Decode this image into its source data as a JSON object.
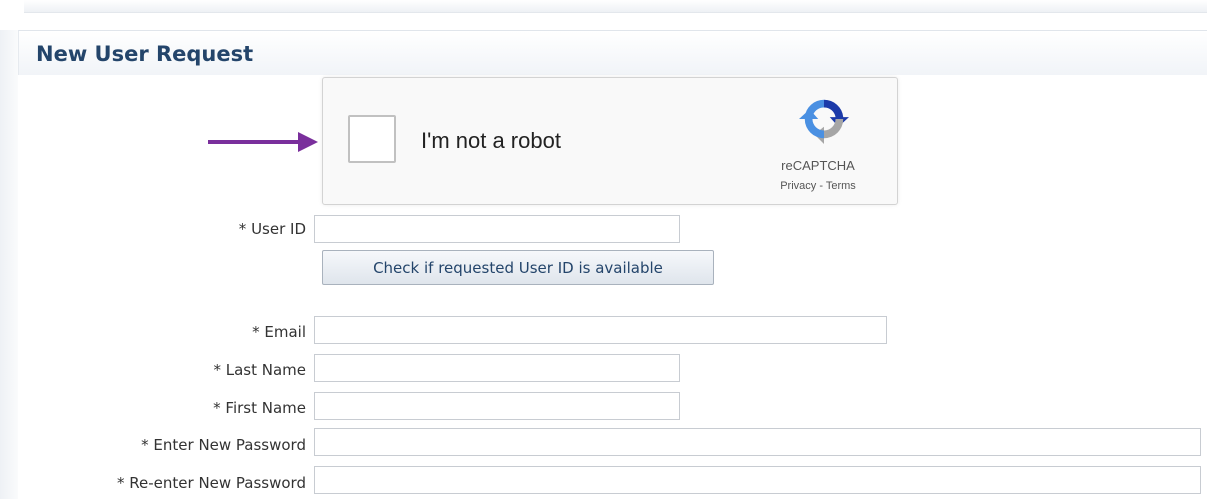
{
  "page": {
    "title": "New User Request"
  },
  "recaptcha": {
    "checkbox_label": "I'm not a robot",
    "brand": "reCAPTCHA",
    "privacy_link": "Privacy",
    "separator": " - ",
    "terms_link": "Terms",
    "checked": false
  },
  "annotation": {
    "arrow_color": "#7a2f9c",
    "icon": "arrow-right-icon"
  },
  "form": {
    "user_id_label": "* User ID",
    "user_id_value": "",
    "check_button_label": "Check if requested User ID is available",
    "email_label": "* Email",
    "email_value": "",
    "last_name_label": "* Last Name",
    "last_name_value": "",
    "first_name_label": "* First Name",
    "first_name_value": "",
    "new_password_label": "* Enter New Password",
    "new_password_value": "",
    "reenter_password_label": "* Re-enter New Password",
    "reenter_password_value": ""
  },
  "colors": {
    "title": "#24456b",
    "accent": "#7a2f9c",
    "recaptcha_blue": "#1c3aa9"
  }
}
